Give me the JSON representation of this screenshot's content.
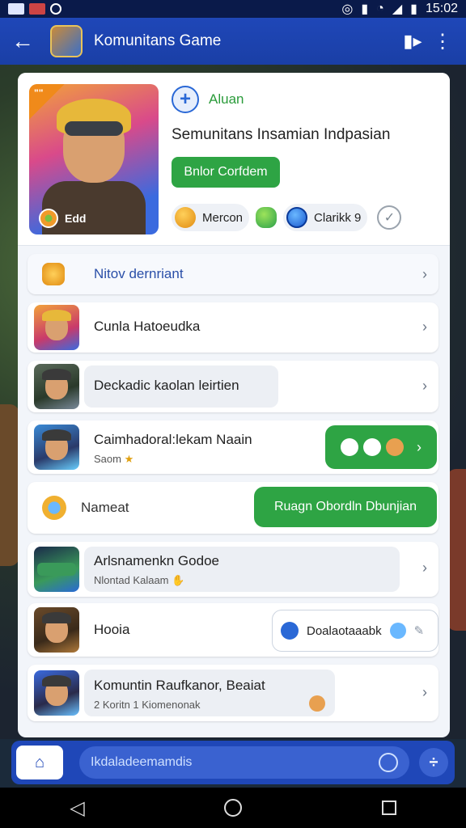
{
  "status_bar": {
    "time": "15:02"
  },
  "app_bar": {
    "title": "Komunitans Game"
  },
  "hero": {
    "corner_label": "\"\"",
    "badge_label": "Edd",
    "alliance_label": "Aluan",
    "title": "Semunitans Insamian Indpasian",
    "join_button": "Bnlor Corfdem",
    "stats": [
      {
        "label": "Mercon"
      },
      {
        "label": "Clarikk 9"
      }
    ]
  },
  "rows": [
    {
      "label": "Nitov dernriant"
    },
    {
      "label": "Cunla Hatoeudka"
    },
    {
      "label": "Deckadic kaolan leirtien"
    },
    {
      "label": "Caimhadoral:lekam Naain",
      "sub": "Saom"
    },
    {
      "label": "Nameat",
      "button": "Ruagn Obordln Dbunjian"
    },
    {
      "label": "Arlsnamenkn Godoe",
      "sub": "Nlontad Kalaam"
    },
    {
      "label": "Hooia",
      "button": "Doalaotaaabk"
    },
    {
      "label": "Komuntin Raufkanor, Beaiat",
      "sub": "2 Koritn 1 Kiomenonak"
    }
  ],
  "message_input": {
    "placeholder": "Ikdaladeemamdis"
  }
}
